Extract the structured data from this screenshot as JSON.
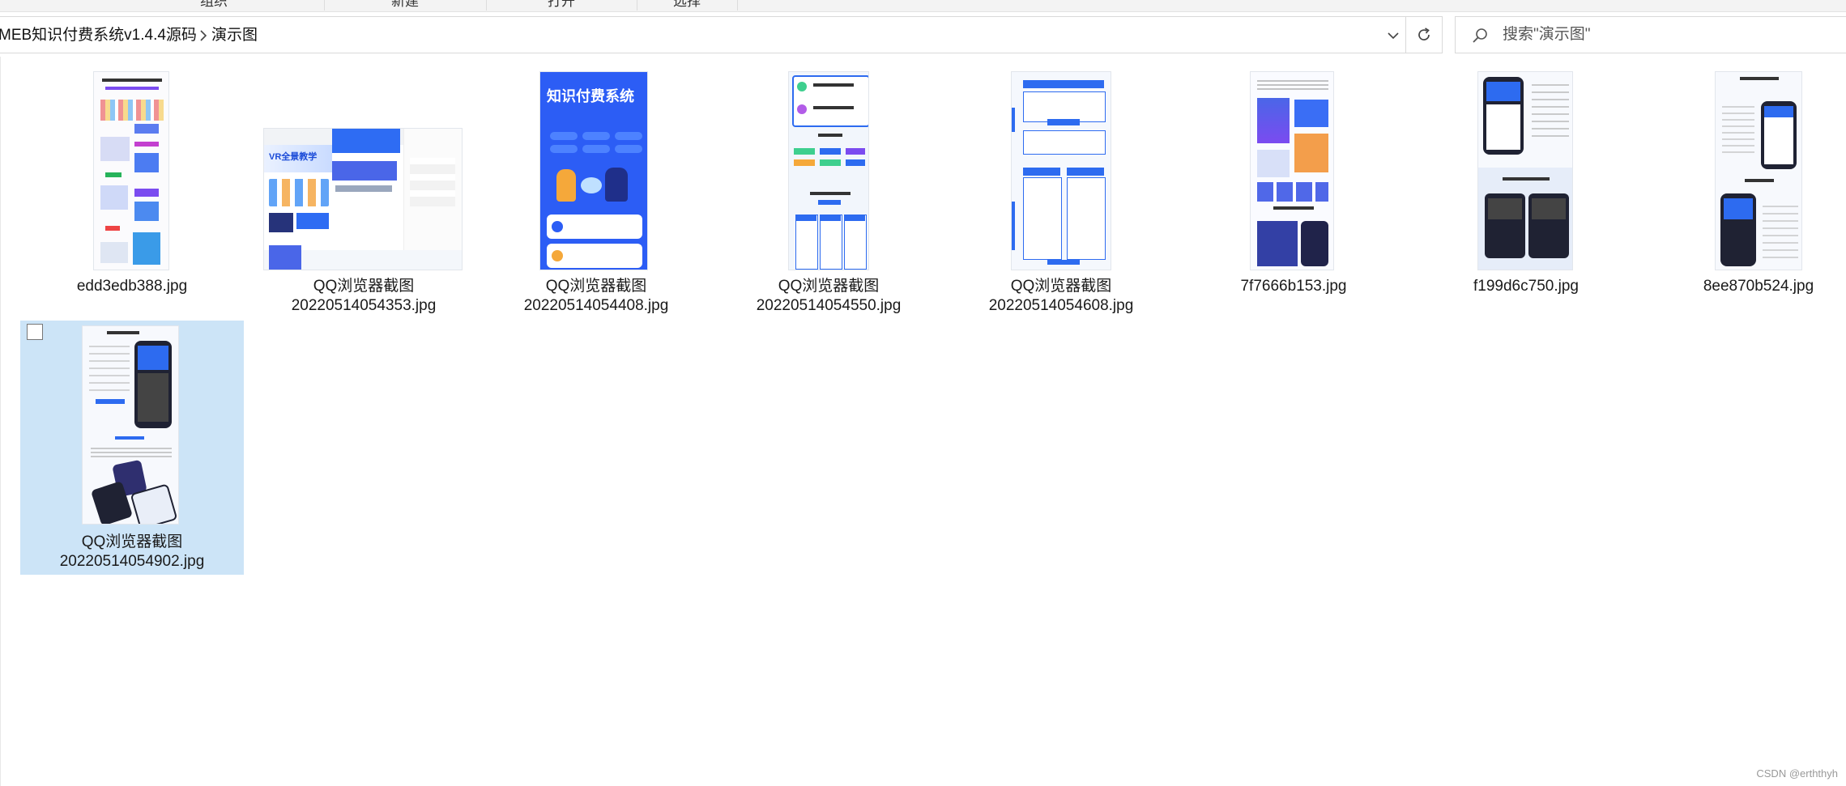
{
  "ribbon": {
    "groups": [
      "组织",
      "新建",
      "打开",
      "选择"
    ]
  },
  "address": {
    "breadcrumbs": [
      "MEB知识付费系统v1.4.4源码",
      "演示图"
    ]
  },
  "search": {
    "placeholder": "搜索\"演示图\""
  },
  "files": [
    {
      "name_line1": "edd3edb388.jpg",
      "name_line2": "",
      "selected": false
    },
    {
      "name_line1": "QQ浏览器截图",
      "name_line2": "20220514054353.jpg",
      "selected": false
    },
    {
      "name_line1": "QQ浏览器截图",
      "name_line2": "20220514054408.jpg",
      "selected": false
    },
    {
      "name_line1": "QQ浏览器截图",
      "name_line2": "20220514054550.jpg",
      "selected": false
    },
    {
      "name_line1": "QQ浏览器截图",
      "name_line2": "20220514054608.jpg",
      "selected": false
    },
    {
      "name_line1": "7f7666b153.jpg",
      "name_line2": "",
      "selected": false
    },
    {
      "name_line1": "f199d6c750.jpg",
      "name_line2": "",
      "selected": false
    },
    {
      "name_line1": "8ee870b524.jpg",
      "name_line2": "",
      "selected": false
    },
    {
      "name_line1": "QQ浏览器截图",
      "name_line2": "20220514054902.jpg",
      "selected": true
    }
  ],
  "thumb_texts": {
    "banner_title": "知识付费系统",
    "vr_banner": "VR全景教学"
  },
  "watermark": "CSDN @erththyh",
  "colors": {
    "selection": "#cce4f7",
    "accent_blue": "#2d6bf0"
  }
}
